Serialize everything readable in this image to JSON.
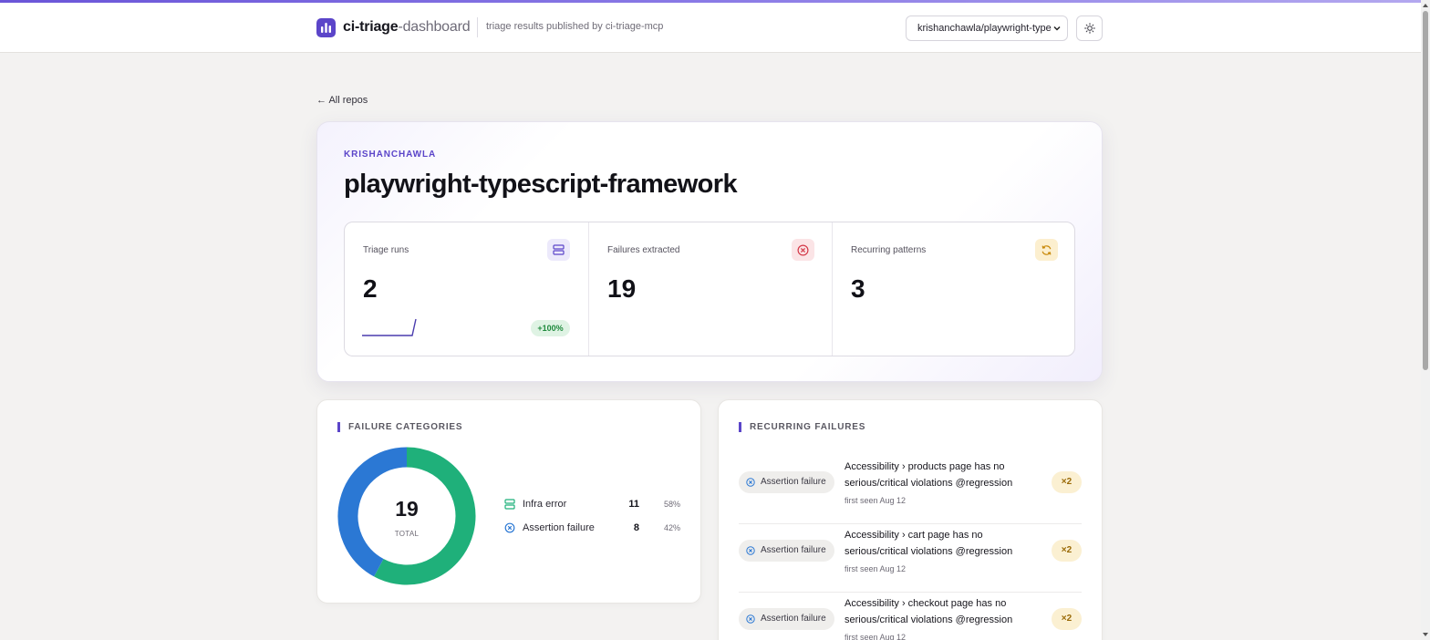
{
  "header": {
    "brand_primary": "ci-triage",
    "brand_secondary": "-dashboard",
    "tagline": "triage results published by ci-triage-mcp",
    "repo_select_value": "krishanchawla/playwright-type",
    "theme_icon": "sun-icon"
  },
  "nav": {
    "back_label": "← All repos"
  },
  "repo": {
    "owner": "KRISHANCHAWLA",
    "name": "playwright-typescript-framework"
  },
  "stats": [
    {
      "label": "Triage runs",
      "value": "2",
      "icon": "server-stack-icon",
      "delta": "+100%"
    },
    {
      "label": "Failures extracted",
      "value": "19",
      "icon": "x-circle-icon"
    },
    {
      "label": "Recurring patterns",
      "value": "3",
      "icon": "refresh-icon"
    }
  ],
  "categories": {
    "title": "FAILURE CATEGORIES",
    "total": "19",
    "total_label": "TOTAL",
    "items": [
      {
        "name": "Infra error",
        "count": "11",
        "pct": "58%",
        "color": "#1fb07a",
        "icon": "server-icon"
      },
      {
        "name": "Assertion failure",
        "count": "8",
        "pct": "42%",
        "color": "#2b78d4",
        "icon": "x-circle-icon"
      }
    ]
  },
  "recurring": {
    "title": "RECURRING FAILURES",
    "items": [
      {
        "badge": "Assertion failure",
        "title": "Accessibility › products page has no serious/critical violations @regression",
        "seen": "first seen Aug 12",
        "count": "×2"
      },
      {
        "badge": "Assertion failure",
        "title": "Accessibility › cart page has no serious/critical violations @regression",
        "seen": "first seen Aug 12",
        "count": "×2"
      },
      {
        "badge": "Assertion failure",
        "title": "Accessibility › checkout page has no serious/critical violations @regression",
        "seen": "first seen Aug 12",
        "count": "×2"
      }
    ]
  },
  "colors": {
    "accent": "#5b45c9",
    "infra": "#1fb07a",
    "assertion": "#2b78d4",
    "danger": "#d43a4a",
    "warning": "#c98a0c"
  }
}
